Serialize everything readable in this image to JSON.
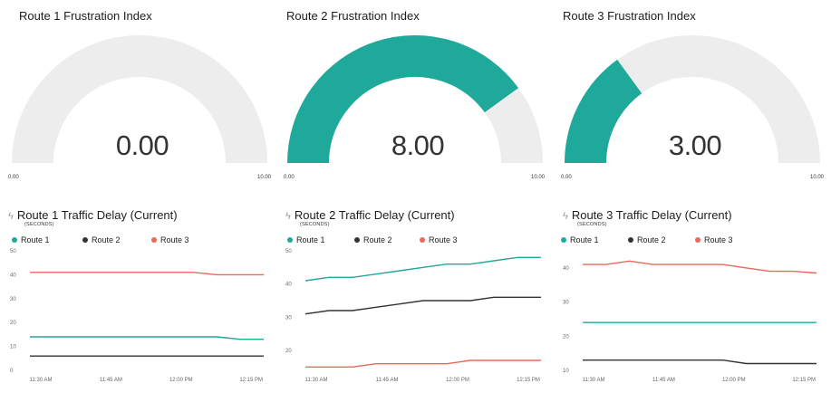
{
  "colors": {
    "route1": "#1fa99b",
    "route2": "#333333",
    "route3": "#e8685c",
    "track": "#ededed"
  },
  "gauges": [
    {
      "title": "Route 1 Frustration Index",
      "value_label": "0.00",
      "value": 0,
      "min_label": "0.00",
      "max_label": "10.00",
      "min": 0,
      "max": 10
    },
    {
      "title": "Route 2 Frustration Index",
      "value_label": "8.00",
      "value": 8,
      "min_label": "0.00",
      "max_label": "10.00",
      "min": 0,
      "max": 10
    },
    {
      "title": "Route 3 Frustration Index",
      "value_label": "3.00",
      "value": 3,
      "min_label": "0.00",
      "max_label": "10.00",
      "min": 0,
      "max": 10
    }
  ],
  "charts": [
    {
      "title": "Route 1 Traffic Delay (Current)",
      "subtitle": "(SECONDS)",
      "icon": "lightning-icon",
      "legend": [
        "Route 1",
        "Route 2",
        "Route 3"
      ]
    },
    {
      "title": "Route 2 Traffic Delay (Current)",
      "subtitle": "(SECONDS)",
      "icon": "lightning-icon",
      "legend": [
        "Route 1",
        "Route 2",
        "Route 3"
      ]
    },
    {
      "title": "Route 3 Traffic Delay (Current)",
      "subtitle": "(SECONDS)",
      "icon": "lightning-icon",
      "legend": [
        "Route 1",
        "Route 2",
        "Route 3"
      ]
    }
  ],
  "chart_data": [
    {
      "type": "line",
      "title": "Route 1 Traffic Delay (Current)",
      "ylabel": "(SECONDS)",
      "x": [
        "11:30",
        "11:35",
        "11:40",
        "11:45",
        "11:50",
        "11:55",
        "12:00",
        "12:05",
        "12:10",
        "12:15",
        "12:20"
      ],
      "xticks": [
        "11:30 AM",
        "11:45 AM",
        "12:00 PM",
        "12:15 PM"
      ],
      "xtick_index": [
        0,
        3,
        6,
        9
      ],
      "yticks": [
        0,
        10,
        20,
        30,
        40,
        50
      ],
      "ylim": [
        0,
        50
      ],
      "series": [
        {
          "name": "Route 1",
          "values": [
            14,
            14,
            14,
            14,
            14,
            14,
            14,
            14,
            14,
            13,
            13
          ]
        },
        {
          "name": "Route 2",
          "values": [
            6,
            6,
            6,
            6,
            6,
            6,
            6,
            6,
            6,
            6,
            6
          ]
        },
        {
          "name": "Route 3",
          "values": [
            41,
            41,
            41,
            41,
            41,
            41,
            41,
            41,
            40,
            40,
            40
          ]
        }
      ]
    },
    {
      "type": "line",
      "title": "Route 2 Traffic Delay (Current)",
      "ylabel": "(SECONDS)",
      "x": [
        "11:30",
        "11:35",
        "11:40",
        "11:45",
        "11:50",
        "11:55",
        "12:00",
        "12:05",
        "12:10",
        "12:15",
        "12:20"
      ],
      "xticks": [
        "11:30 AM",
        "11:45 AM",
        "12:00 PM",
        "12:15 PM"
      ],
      "xtick_index": [
        0,
        3,
        6,
        9
      ],
      "yticks": [
        20,
        30,
        40,
        50
      ],
      "ylim": [
        14,
        50
      ],
      "series": [
        {
          "name": "Route 1",
          "values": [
            41,
            42,
            42,
            43,
            44,
            45,
            46,
            46,
            47,
            48,
            48
          ]
        },
        {
          "name": "Route 2",
          "values": [
            31,
            32,
            32,
            33,
            34,
            35,
            35,
            35,
            36,
            36,
            36
          ]
        },
        {
          "name": "Route 3",
          "values": [
            15,
            15,
            15,
            16,
            16,
            16,
            16,
            17,
            17,
            17,
            17
          ]
        }
      ]
    },
    {
      "type": "line",
      "title": "Route 3 Traffic Delay (Current)",
      "ylabel": "(SECONDS)",
      "x": [
        "11:30",
        "11:35",
        "11:40",
        "11:45",
        "11:50",
        "11:55",
        "12:00",
        "12:05",
        "12:10",
        "12:15",
        "12:20"
      ],
      "xticks": [
        "11:30 AM",
        "11:45 AM",
        "12:00 PM",
        "12:15 PM"
      ],
      "xtick_index": [
        0,
        3,
        6,
        9
      ],
      "yticks": [
        10,
        20,
        30,
        40
      ],
      "ylim": [
        10,
        45
      ],
      "series": [
        {
          "name": "Route 1",
          "values": [
            24,
            24,
            24,
            24,
            24,
            24,
            24,
            24,
            24,
            24,
            24
          ]
        },
        {
          "name": "Route 2",
          "values": [
            13,
            13,
            13,
            13,
            13,
            13,
            13,
            12,
            12,
            12,
            12
          ]
        },
        {
          "name": "Route 3",
          "values": [
            41,
            41,
            42,
            41,
            41,
            41,
            41,
            40,
            39,
            39,
            38.5
          ]
        }
      ]
    }
  ]
}
